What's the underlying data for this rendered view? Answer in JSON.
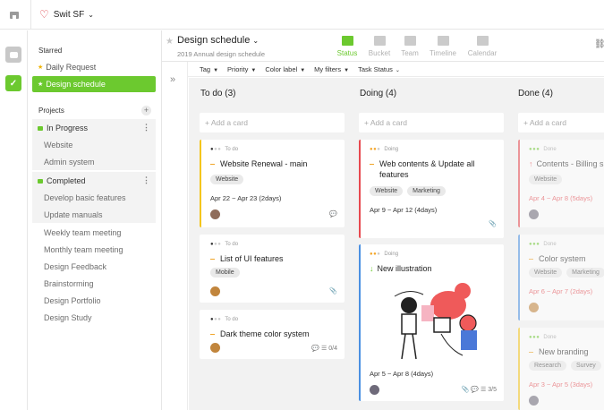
{
  "workspace": {
    "name": "Swit SF"
  },
  "sidebar": {
    "starred_heading": "Starred",
    "starred": [
      {
        "label": "Daily Request"
      },
      {
        "label": "Design schedule"
      }
    ],
    "projects_heading": "Projects",
    "groups": [
      {
        "label": "In Progress",
        "items": [
          "Website",
          "Admin system"
        ]
      },
      {
        "label": "Completed",
        "items": [
          "Develop basic features",
          "Update manuals"
        ]
      }
    ],
    "projects": [
      "Weekly team meeting",
      "Monthly team meeting",
      "Design Feedback",
      "Brainstorming",
      "Design Portfolio",
      "Design Study"
    ]
  },
  "project": {
    "title": "Design schedule",
    "subtitle": "2019 Annual design schedule"
  },
  "views": [
    {
      "label": "Status",
      "active": true
    },
    {
      "label": "Bucket"
    },
    {
      "label": "Team"
    },
    {
      "label": "Timeline"
    },
    {
      "label": "Calendar"
    }
  ],
  "filters": [
    "Tag",
    "Priority",
    "Color label",
    "My filters",
    "Task Status"
  ],
  "columns": [
    {
      "title": "To do (3)",
      "add": "+ Add a card"
    },
    {
      "title": "Doing (4)",
      "add": "+ Add a card"
    },
    {
      "title": "Done (4)",
      "add": "+ Add a card"
    }
  ],
  "cards": {
    "todo": [
      {
        "status": "To do",
        "title": "Website Renewal - main",
        "tags": [
          "Website"
        ],
        "date": "Apr 22 ~ Apr 23 (2days)"
      },
      {
        "status": "To do",
        "title": "List of UI features",
        "tags": [
          "Mobile"
        ]
      },
      {
        "status": "To do",
        "title": "Dark theme color system",
        "checklist": "0/4"
      }
    ],
    "doing": [
      {
        "status": "Doing",
        "title_line1": "Web contents & Update all",
        "title_line2": "features",
        "tags": [
          "Website",
          "Marketing"
        ],
        "date": "Apr 9 ~ Apr 12 (4days)"
      },
      {
        "status": "Doing",
        "title": "New illustration",
        "date": "Apr 5 ~ Apr 8 (4days)",
        "checklist": "3/5"
      }
    ],
    "done": [
      {
        "status": "Done",
        "title": "Contents - Billing s",
        "tags": [
          "Website"
        ],
        "date": "Apr 4 ~ Apr 8 (5days)"
      },
      {
        "status": "Done",
        "title": "Color system",
        "tags": [
          "Website",
          "Marketing"
        ],
        "date": "Apr 6 ~ Apr 7 (2days)"
      },
      {
        "status": "Done",
        "title": "New branding",
        "tags": [
          "Research",
          "Survey"
        ],
        "date": "Apr 3 ~ Apr 5 (3days)"
      }
    ]
  },
  "colors": {
    "accent": "#6cc92f",
    "todo": "#f4c51c",
    "doing": "#e7494f",
    "blue": "#4a90e2"
  }
}
